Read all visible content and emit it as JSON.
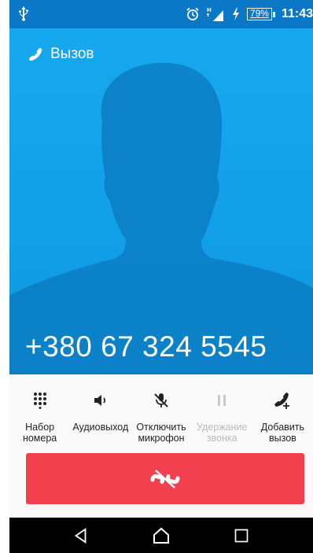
{
  "status_bar": {
    "battery": "79%",
    "time": "11:43",
    "icons": [
      "usb-icon",
      "alarm-clock-icon",
      "signal-4g-icon",
      "charging-bolt-icon",
      "battery-icon"
    ]
  },
  "call": {
    "title": "Вызов",
    "number": "+380 67 324 5545"
  },
  "controls": [
    {
      "label_line1": "Набор",
      "label_line2": "номера",
      "icon": "dialpad-icon",
      "enabled": true
    },
    {
      "label_line1": "Аудиовыход",
      "label_line2": "",
      "icon": "speaker-icon",
      "enabled": true
    },
    {
      "label_line1": "Отключить",
      "label_line2": "микрофон",
      "icon": "mic-off-icon",
      "enabled": true
    },
    {
      "label_line1": "Удержание",
      "label_line2": "звонка",
      "icon": "pause-icon",
      "enabled": false
    },
    {
      "label_line1": "Добавить",
      "label_line2": "вызов",
      "icon": "add-call-icon",
      "enabled": true
    }
  ],
  "colors": {
    "status_bar": "#0b78c7",
    "call_background": "#12a0e8",
    "silhouette": "#0a7dc3",
    "end_call": "#f2404f",
    "nav_bar": "#000000"
  },
  "nav": [
    "back-icon",
    "home-icon",
    "recents-icon"
  ]
}
